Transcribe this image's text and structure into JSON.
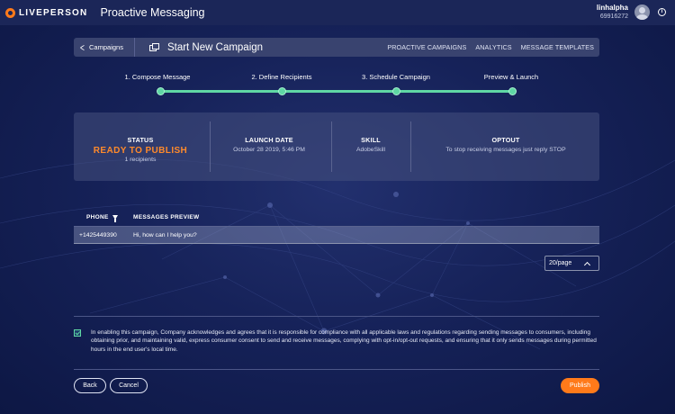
{
  "header": {
    "logo_text": "LIVEPERSON",
    "app_title": "Proactive Messaging",
    "user_name": "linhalpha",
    "user_id": "69916272"
  },
  "campaign_bar": {
    "breadcrumb": "Campaigns",
    "title": "Start New Campaign",
    "nav": [
      "PROACTIVE CAMPAIGNS",
      "ANALYTICS",
      "MESSAGE TEMPLATES"
    ]
  },
  "steps": [
    {
      "label": "1. Compose Message"
    },
    {
      "label": "2. Define Recipients"
    },
    {
      "label": "3. Schedule Campaign"
    },
    {
      "label": "Preview & Launch"
    }
  ],
  "status": {
    "status_label": "STATUS",
    "status_value": "READY TO PUBLISH",
    "recipients": "1 recipients",
    "launch_label": "LAUNCH DATE",
    "launch_value": "October 28 2019, 5:46 PM",
    "skill_label": "SKILL",
    "skill_value": "AdobeSkill",
    "optout_label": "OPTOUT",
    "optout_value": "To stop receiving messages just reply STOP"
  },
  "table": {
    "columns": [
      "PHONE",
      "MESSAGES PREVIEW"
    ],
    "rows": [
      {
        "phone": "+1425449390",
        "message": "Hi, how can I help you?"
      }
    ]
  },
  "pagination": {
    "page_size": "20/page"
  },
  "consent": {
    "checked": true,
    "text": "In enabling this campaign, Company acknowledges and agrees that it is responsible for compliance with all applicable laws and regulations regarding sending messages to consumers, including obtaining prior, and maintaining valid, express consumer consent to send and receive messages, complying with opt-in/opt-out requests, and ensuring that it only sends messages during permitted hours in the end user's local time."
  },
  "actions": {
    "back": "Back",
    "cancel": "Cancel",
    "publish": "Publish"
  },
  "colors": {
    "accent_orange": "#ff7a1a",
    "step_green": "#5fd7a4",
    "background": "#162259"
  }
}
